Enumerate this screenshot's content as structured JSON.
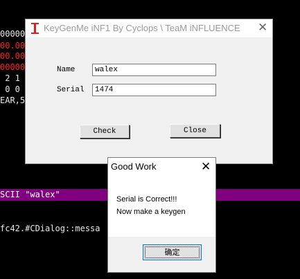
{
  "background": {
    "lines": [
      {
        "text": "00000",
        "color": "white"
      },
      {
        "text": "00.00",
        "color": "red"
      },
      {
        "text": "00.00",
        "color": "red"
      },
      {
        "text": "00000",
        "color": "red"
      },
      {
        "text": " 2 1",
        "color": "white"
      },
      {
        "text": " 0 0",
        "color": "white"
      },
      {
        "text": "EAR,5",
        "color": "white"
      }
    ],
    "highlight_line": "SCII \"walex\"",
    "bottom_line": "fc42.#CDialog::messa",
    "highlight_color": "#800080"
  },
  "main_dialog": {
    "title": "KeyGenMe iNF1 By Cyclops \\ TeaM iNFLUENCE",
    "name_label": "Name",
    "name_value": "walex",
    "serial_label": "Serial",
    "serial_value": "1474",
    "check_button": "Check",
    "close_button": "Close",
    "close_icon": "close-icon",
    "app_icon": "red-i-beam-icon",
    "app_icon_color": "#e02020"
  },
  "message_box": {
    "title": "Good Work",
    "line1": "Serial is Correct!!!",
    "line2": "Now make a keygen",
    "ok_button": "确定",
    "close_icon": "close-icon"
  }
}
